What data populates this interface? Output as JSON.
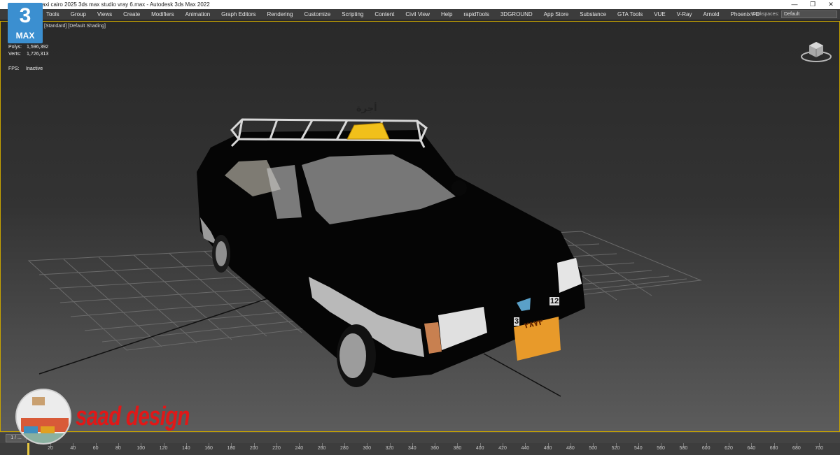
{
  "window": {
    "title": "axi cairo 2025 3ds max studio vray 6.max - Autodesk 3ds Max 2022",
    "minimize": "—",
    "maximize": "❐",
    "close": "✕"
  },
  "logo": {
    "number": "3",
    "label": "MAX"
  },
  "menu": {
    "items": [
      "Tools",
      "Group",
      "Views",
      "Create",
      "Modifiers",
      "Animation",
      "Graph Editors",
      "Rendering",
      "Customize",
      "Scripting",
      "Content",
      "Civil View",
      "Help",
      "rapidTools",
      "3DGROUND",
      "App Store",
      "Substance",
      "GTA Tools",
      "VUE",
      "V-Ray",
      "Arnold",
      "Phoenix FD"
    ],
    "workspaces_label": "Workspaces:",
    "workspaces_value": "Default"
  },
  "viewport": {
    "labels": "[Standard] [Default Shading]",
    "stats": {
      "polys_label": "Polys:",
      "polys_value": "1,596,392",
      "verts_label": "Verts:",
      "verts_value": "1,726,313",
      "fps_label": "FPS:",
      "fps_value": "Inactive"
    },
    "taxi_sign": "أجرة",
    "plate_left": "3",
    "plate_right": "12",
    "plate_text": "٢٨٧٣",
    "border_color": "#c8a400"
  },
  "overlay": {
    "brand": "saad design"
  },
  "timeline": {
    "handle_label": "1 / ...",
    "ticks": [
      "20",
      "40",
      "60",
      "80",
      "100",
      "120",
      "140",
      "160",
      "180",
      "200",
      "220",
      "240",
      "260",
      "280",
      "300",
      "320",
      "340",
      "360",
      "380",
      "400",
      "420",
      "440",
      "460",
      "480",
      "500",
      "520",
      "540",
      "560",
      "580",
      "600",
      "620",
      "640",
      "660",
      "680",
      "700"
    ]
  }
}
